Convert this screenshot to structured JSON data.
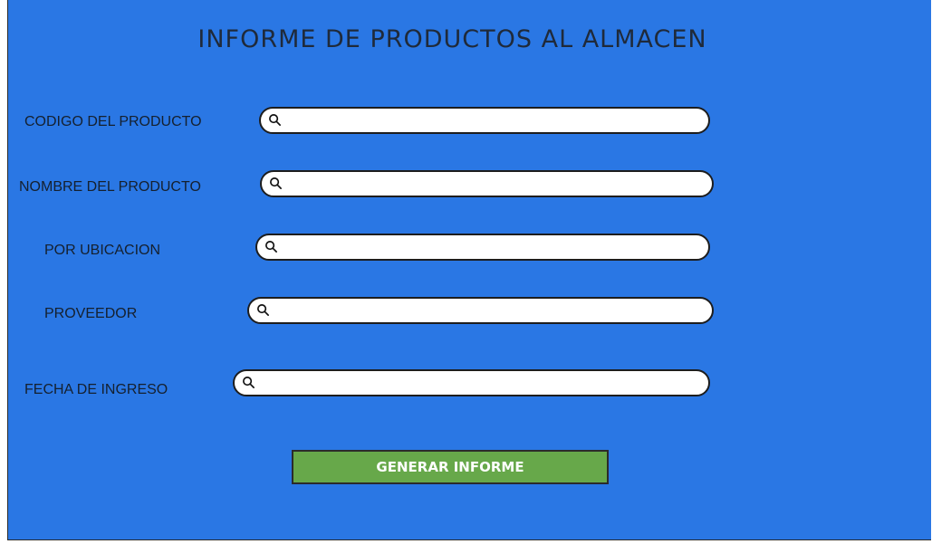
{
  "form": {
    "title": "INFORME DE PRODUCTOS AL ALMACEN",
    "fields": [
      {
        "label": "CODIGO DEL PRODUCTO",
        "value": "",
        "placeholder": ""
      },
      {
        "label": "NOMBRE DEL PRODUCTO",
        "value": "",
        "placeholder": ""
      },
      {
        "label": "POR UBICACION",
        "value": "",
        "placeholder": ""
      },
      {
        "label": "PROVEEDOR",
        "value": "",
        "placeholder": ""
      },
      {
        "label": "FECHA DE INGRESO",
        "value": "",
        "placeholder": ""
      }
    ],
    "submit_label": "GENERAR INFORME",
    "field_icon": "search-icon"
  },
  "colors": {
    "background": "#2a77e4",
    "button": "#67a84a",
    "button_text": "#ffffff",
    "input_background": "#ffffff",
    "text": "#15202e"
  }
}
